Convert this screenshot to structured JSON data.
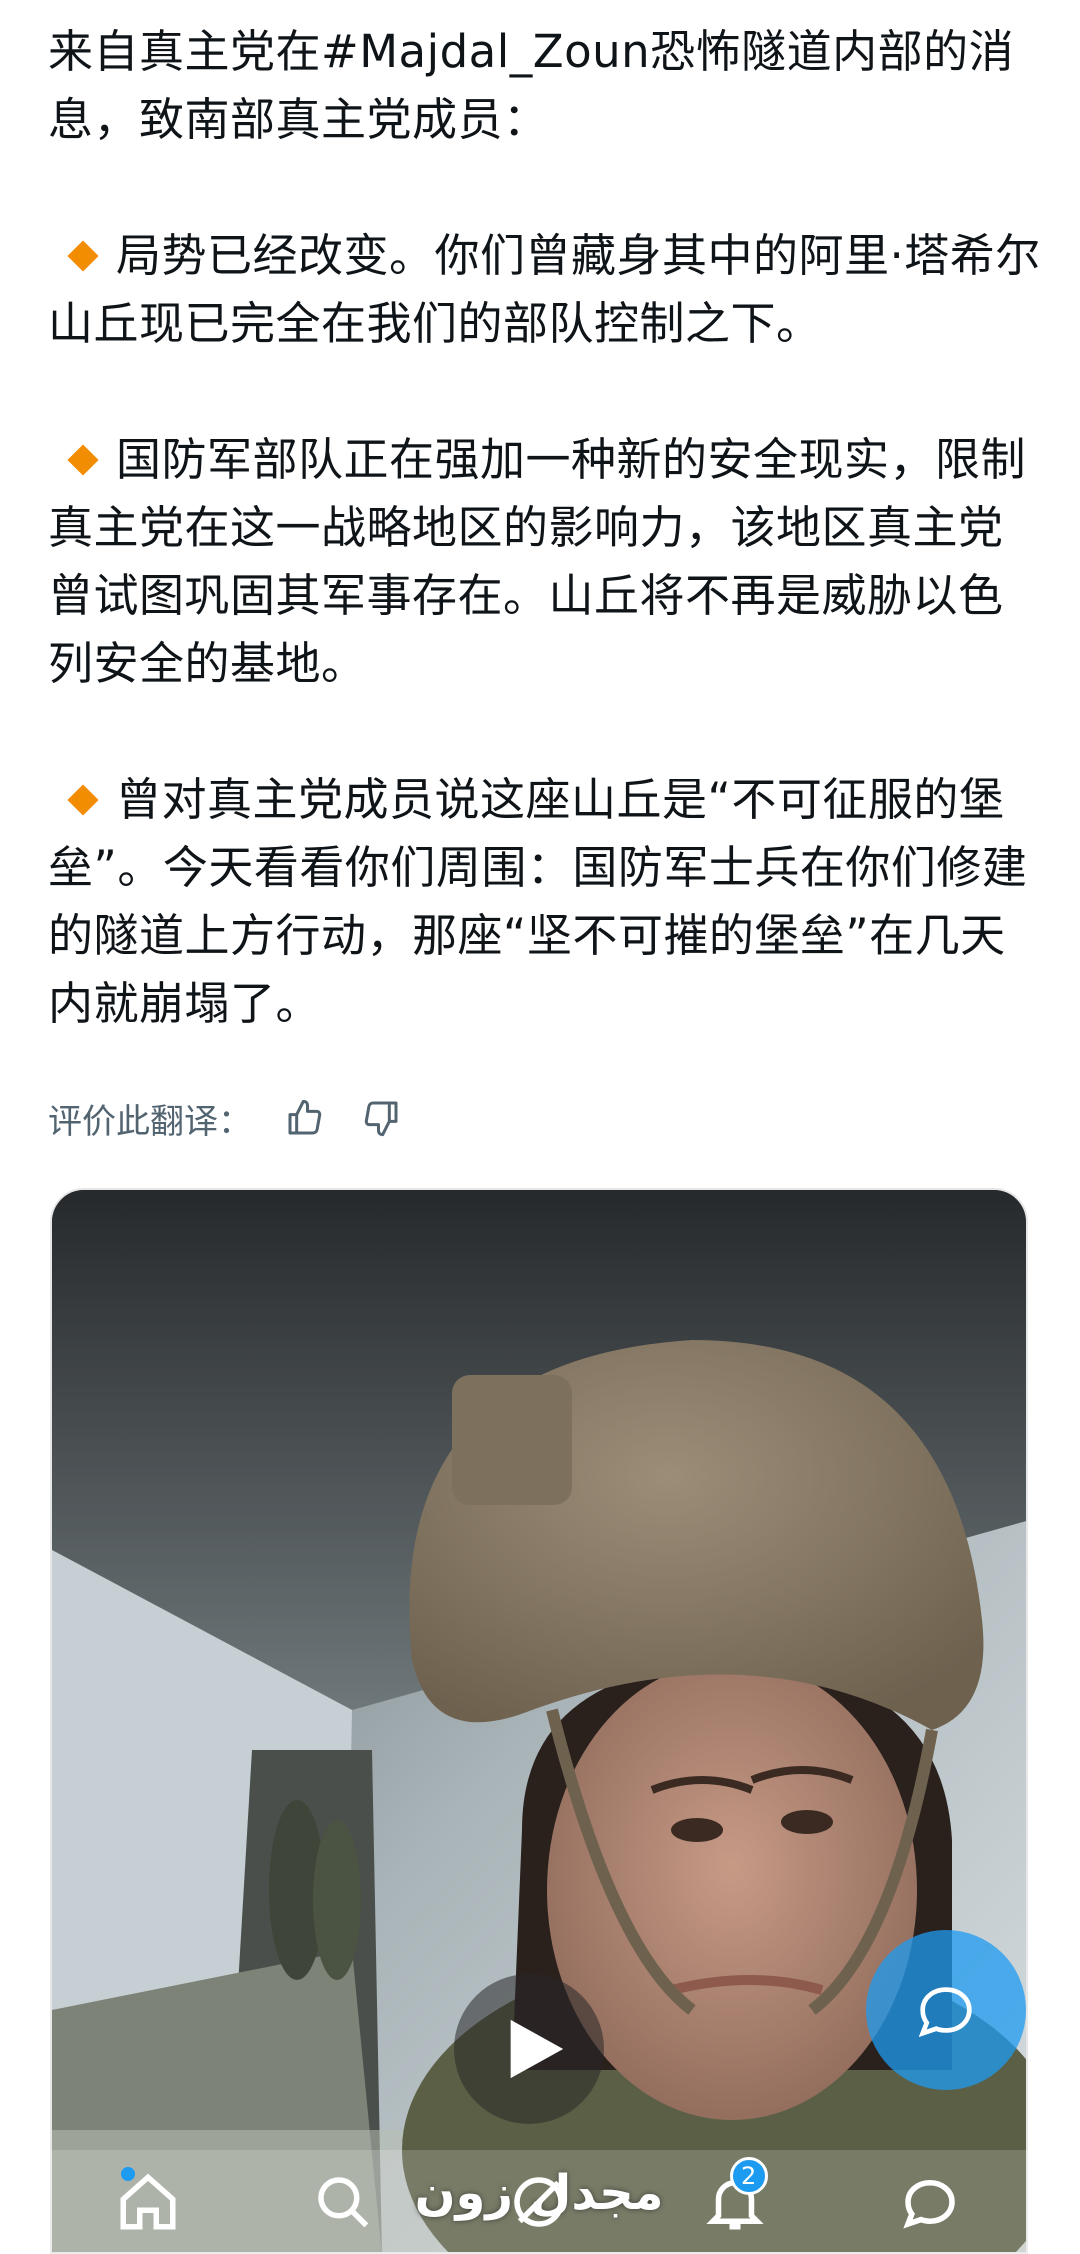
{
  "post": {
    "intro": "来自真主党在#Majdal_Zoun恐怖隧道内部的消息，致南部真主党成员：",
    "bullets": [
      "局势已经改变。你们曾藏身其中的阿里·塔希尔山丘现已完全在我们的部队控制之下。",
      "国防军部队正在强加一种新的安全现实，限制真主党在这一战略地区的影响力，该地区真主党曾试图巩固其军事存在。山丘将不再是威胁以色列安全的基地。",
      "曾对真主党成员说这座山丘是“不可征服的堡垒”。今天看看你们周围：国防军士兵在你们修建的隧道上方行动，那座“坚不可摧的堡垒”在几天内就崩塌了。"
    ],
    "bullet_icon": "orange-diamond-icon",
    "bullet_color": "#f28c00"
  },
  "translation_rating": {
    "label": "评价此翻译：",
    "thumbs_up_icon": "thumbs-up-icon",
    "thumbs_down_icon": "thumbs-down-icon"
  },
  "media": {
    "type": "video",
    "caption": "مجدل زون",
    "play_icon": "play-icon"
  },
  "bottom_nav": {
    "items": [
      "home-icon",
      "search-icon",
      "grok-icon",
      "notifications-icon",
      "messages-icon"
    ],
    "notification_count": "2",
    "accent": "#1d9bf0"
  },
  "compose_icon": "compose-icon"
}
